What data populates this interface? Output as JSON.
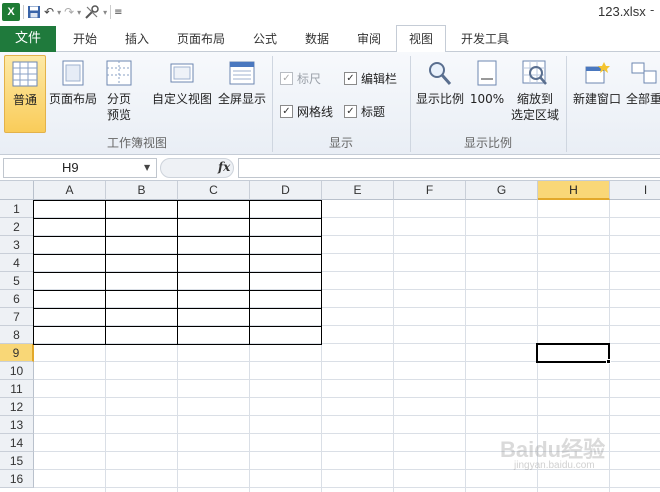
{
  "window": {
    "title": "123.xlsx",
    "dash": "-"
  },
  "qat": {
    "dropdown_glyph": "▾"
  },
  "tabs": {
    "file": "文件",
    "items": [
      {
        "label": "开始"
      },
      {
        "label": "插入"
      },
      {
        "label": "页面布局"
      },
      {
        "label": "公式"
      },
      {
        "label": "数据"
      },
      {
        "label": "审阅"
      },
      {
        "label": "视图",
        "active": true
      },
      {
        "label": "开发工具"
      }
    ]
  },
  "ribbon": {
    "workbook_views": {
      "group_label": "工作簿视图",
      "normal": "普通",
      "page_layout": "页面布局",
      "page_break_1": "分页",
      "page_break_2": "预览",
      "custom_view": "自定义视图",
      "full_screen": "全屏显示"
    },
    "show": {
      "group_label": "显示",
      "ruler": "标尺",
      "formula_bar": "编辑栏",
      "gridlines": "网格线",
      "headings": "标题"
    },
    "zoom": {
      "group_label": "显示比例",
      "zoom": "显示比例",
      "hundred": "100%",
      "zoom_sel_1": "缩放到",
      "zoom_sel_2": "选定区域"
    },
    "window": {
      "new_window": "新建窗口",
      "arrange_all": "全部重"
    }
  },
  "formula_bar": {
    "name_box": "H9",
    "fx": "fx",
    "value": ""
  },
  "sheet": {
    "columns": [
      "A",
      "B",
      "C",
      "D",
      "E",
      "F",
      "G",
      "H",
      "I"
    ],
    "rows": [
      "1",
      "2",
      "3",
      "4",
      "5",
      "6",
      "7",
      "8",
      "9",
      "10",
      "11",
      "12",
      "13",
      "14",
      "15",
      "16"
    ],
    "selected_cell": "H9",
    "bordered_range": "A1:D8"
  },
  "watermark": {
    "brand": "Baidu经验",
    "url": "jingyan.baidu.com"
  }
}
